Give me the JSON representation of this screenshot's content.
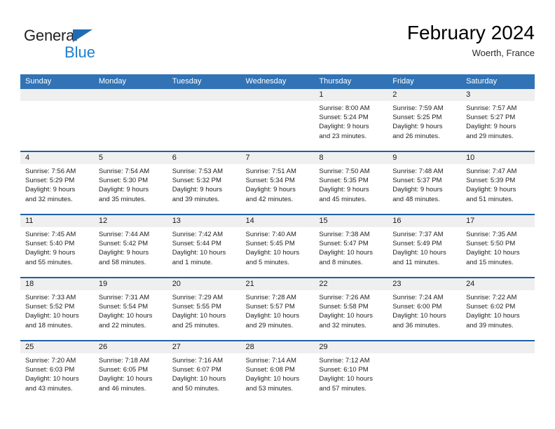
{
  "brand": {
    "name_line1": "General",
    "name_line2": "Blue",
    "triangle_color": "#1f6cb4",
    "blue_text_color": "#1f7fd0"
  },
  "header": {
    "title": "February 2024",
    "subtitle": "Woerth, France"
  },
  "theme": {
    "header_blue": "#3273b6",
    "row_divider_blue": "#1f5fa8",
    "daynum_band_gray": "#efefef"
  },
  "weekday_headers": [
    "Sunday",
    "Monday",
    "Tuesday",
    "Wednesday",
    "Thursday",
    "Friday",
    "Saturday"
  ],
  "weeks": [
    [
      {
        "day": "",
        "sunrise": "",
        "sunset": "",
        "daylight_line1": "",
        "daylight_line2": ""
      },
      {
        "day": "",
        "sunrise": "",
        "sunset": "",
        "daylight_line1": "",
        "daylight_line2": ""
      },
      {
        "day": "",
        "sunrise": "",
        "sunset": "",
        "daylight_line1": "",
        "daylight_line2": ""
      },
      {
        "day": "",
        "sunrise": "",
        "sunset": "",
        "daylight_line1": "",
        "daylight_line2": ""
      },
      {
        "day": "1",
        "sunrise": "Sunrise: 8:00 AM",
        "sunset": "Sunset: 5:24 PM",
        "daylight_line1": "Daylight: 9 hours",
        "daylight_line2": "and 23 minutes."
      },
      {
        "day": "2",
        "sunrise": "Sunrise: 7:59 AM",
        "sunset": "Sunset: 5:25 PM",
        "daylight_line1": "Daylight: 9 hours",
        "daylight_line2": "and 26 minutes."
      },
      {
        "day": "3",
        "sunrise": "Sunrise: 7:57 AM",
        "sunset": "Sunset: 5:27 PM",
        "daylight_line1": "Daylight: 9 hours",
        "daylight_line2": "and 29 minutes."
      }
    ],
    [
      {
        "day": "4",
        "sunrise": "Sunrise: 7:56 AM",
        "sunset": "Sunset: 5:29 PM",
        "daylight_line1": "Daylight: 9 hours",
        "daylight_line2": "and 32 minutes."
      },
      {
        "day": "5",
        "sunrise": "Sunrise: 7:54 AM",
        "sunset": "Sunset: 5:30 PM",
        "daylight_line1": "Daylight: 9 hours",
        "daylight_line2": "and 35 minutes."
      },
      {
        "day": "6",
        "sunrise": "Sunrise: 7:53 AM",
        "sunset": "Sunset: 5:32 PM",
        "daylight_line1": "Daylight: 9 hours",
        "daylight_line2": "and 39 minutes."
      },
      {
        "day": "7",
        "sunrise": "Sunrise: 7:51 AM",
        "sunset": "Sunset: 5:34 PM",
        "daylight_line1": "Daylight: 9 hours",
        "daylight_line2": "and 42 minutes."
      },
      {
        "day": "8",
        "sunrise": "Sunrise: 7:50 AM",
        "sunset": "Sunset: 5:35 PM",
        "daylight_line1": "Daylight: 9 hours",
        "daylight_line2": "and 45 minutes."
      },
      {
        "day": "9",
        "sunrise": "Sunrise: 7:48 AM",
        "sunset": "Sunset: 5:37 PM",
        "daylight_line1": "Daylight: 9 hours",
        "daylight_line2": "and 48 minutes."
      },
      {
        "day": "10",
        "sunrise": "Sunrise: 7:47 AM",
        "sunset": "Sunset: 5:39 PM",
        "daylight_line1": "Daylight: 9 hours",
        "daylight_line2": "and 51 minutes."
      }
    ],
    [
      {
        "day": "11",
        "sunrise": "Sunrise: 7:45 AM",
        "sunset": "Sunset: 5:40 PM",
        "daylight_line1": "Daylight: 9 hours",
        "daylight_line2": "and 55 minutes."
      },
      {
        "day": "12",
        "sunrise": "Sunrise: 7:44 AM",
        "sunset": "Sunset: 5:42 PM",
        "daylight_line1": "Daylight: 9 hours",
        "daylight_line2": "and 58 minutes."
      },
      {
        "day": "13",
        "sunrise": "Sunrise: 7:42 AM",
        "sunset": "Sunset: 5:44 PM",
        "daylight_line1": "Daylight: 10 hours",
        "daylight_line2": "and 1 minute."
      },
      {
        "day": "14",
        "sunrise": "Sunrise: 7:40 AM",
        "sunset": "Sunset: 5:45 PM",
        "daylight_line1": "Daylight: 10 hours",
        "daylight_line2": "and 5 minutes."
      },
      {
        "day": "15",
        "sunrise": "Sunrise: 7:38 AM",
        "sunset": "Sunset: 5:47 PM",
        "daylight_line1": "Daylight: 10 hours",
        "daylight_line2": "and 8 minutes."
      },
      {
        "day": "16",
        "sunrise": "Sunrise: 7:37 AM",
        "sunset": "Sunset: 5:49 PM",
        "daylight_line1": "Daylight: 10 hours",
        "daylight_line2": "and 11 minutes."
      },
      {
        "day": "17",
        "sunrise": "Sunrise: 7:35 AM",
        "sunset": "Sunset: 5:50 PM",
        "daylight_line1": "Daylight: 10 hours",
        "daylight_line2": "and 15 minutes."
      }
    ],
    [
      {
        "day": "18",
        "sunrise": "Sunrise: 7:33 AM",
        "sunset": "Sunset: 5:52 PM",
        "daylight_line1": "Daylight: 10 hours",
        "daylight_line2": "and 18 minutes."
      },
      {
        "day": "19",
        "sunrise": "Sunrise: 7:31 AM",
        "sunset": "Sunset: 5:54 PM",
        "daylight_line1": "Daylight: 10 hours",
        "daylight_line2": "and 22 minutes."
      },
      {
        "day": "20",
        "sunrise": "Sunrise: 7:29 AM",
        "sunset": "Sunset: 5:55 PM",
        "daylight_line1": "Daylight: 10 hours",
        "daylight_line2": "and 25 minutes."
      },
      {
        "day": "21",
        "sunrise": "Sunrise: 7:28 AM",
        "sunset": "Sunset: 5:57 PM",
        "daylight_line1": "Daylight: 10 hours",
        "daylight_line2": "and 29 minutes."
      },
      {
        "day": "22",
        "sunrise": "Sunrise: 7:26 AM",
        "sunset": "Sunset: 5:58 PM",
        "daylight_line1": "Daylight: 10 hours",
        "daylight_line2": "and 32 minutes."
      },
      {
        "day": "23",
        "sunrise": "Sunrise: 7:24 AM",
        "sunset": "Sunset: 6:00 PM",
        "daylight_line1": "Daylight: 10 hours",
        "daylight_line2": "and 36 minutes."
      },
      {
        "day": "24",
        "sunrise": "Sunrise: 7:22 AM",
        "sunset": "Sunset: 6:02 PM",
        "daylight_line1": "Daylight: 10 hours",
        "daylight_line2": "and 39 minutes."
      }
    ],
    [
      {
        "day": "25",
        "sunrise": "Sunrise: 7:20 AM",
        "sunset": "Sunset: 6:03 PM",
        "daylight_line1": "Daylight: 10 hours",
        "daylight_line2": "and 43 minutes."
      },
      {
        "day": "26",
        "sunrise": "Sunrise: 7:18 AM",
        "sunset": "Sunset: 6:05 PM",
        "daylight_line1": "Daylight: 10 hours",
        "daylight_line2": "and 46 minutes."
      },
      {
        "day": "27",
        "sunrise": "Sunrise: 7:16 AM",
        "sunset": "Sunset: 6:07 PM",
        "daylight_line1": "Daylight: 10 hours",
        "daylight_line2": "and 50 minutes."
      },
      {
        "day": "28",
        "sunrise": "Sunrise: 7:14 AM",
        "sunset": "Sunset: 6:08 PM",
        "daylight_line1": "Daylight: 10 hours",
        "daylight_line2": "and 53 minutes."
      },
      {
        "day": "29",
        "sunrise": "Sunrise: 7:12 AM",
        "sunset": "Sunset: 6:10 PM",
        "daylight_line1": "Daylight: 10 hours",
        "daylight_line2": "and 57 minutes."
      },
      {
        "day": "",
        "sunrise": "",
        "sunset": "",
        "daylight_line1": "",
        "daylight_line2": ""
      },
      {
        "day": "",
        "sunrise": "",
        "sunset": "",
        "daylight_line1": "",
        "daylight_line2": ""
      }
    ]
  ]
}
